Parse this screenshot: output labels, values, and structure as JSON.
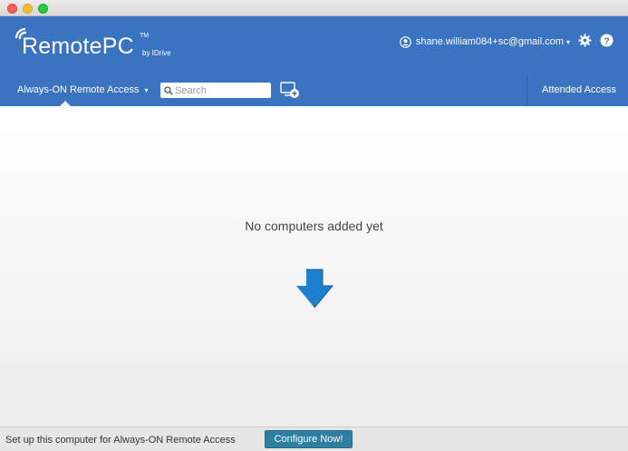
{
  "brand": {
    "name": "RemotePC",
    "tm": "TM",
    "by": "by IDrive"
  },
  "account": {
    "email": "shane.william084+sc@gmail.com",
    "caret": "▾"
  },
  "nav": {
    "always_on_label": "Always-ON Remote Access",
    "always_on_caret": "▾",
    "search_placeholder": "Search",
    "attended_label": "Attended Access"
  },
  "main": {
    "empty_message": "No computers added yet"
  },
  "footer": {
    "text": "Set up this computer for Always-ON Remote Access",
    "button_label": "Configure Now!"
  },
  "colors": {
    "header": "#3a73bf",
    "arrow": "#1e7fcf",
    "button": "#2e7fa2"
  }
}
